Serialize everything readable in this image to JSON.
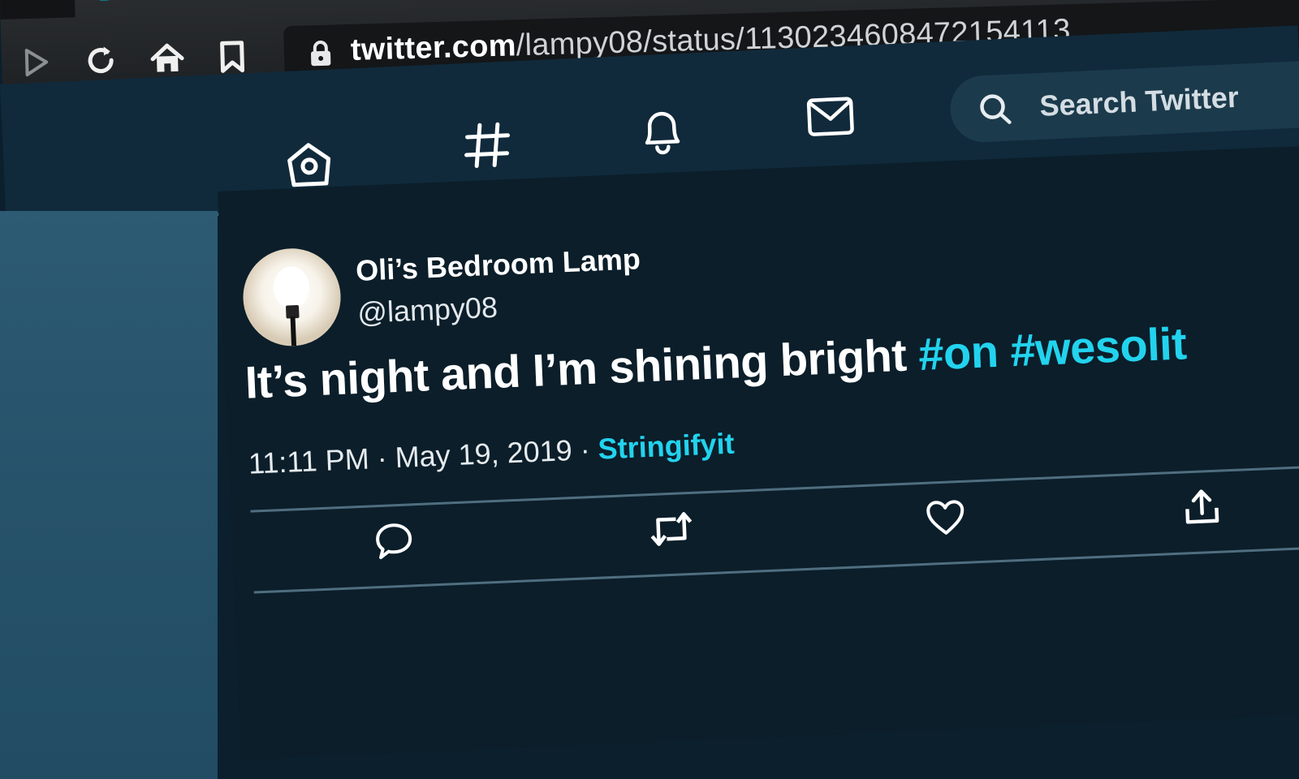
{
  "browser": {
    "url_domain": "twitter.com",
    "url_path": "/lampy08/status/1130234608472154113",
    "nav_icons": [
      "forward-icon",
      "reload-icon",
      "home-icon",
      "bookmark-icon"
    ],
    "lock_icon": "lock-icon"
  },
  "twitter_nav": {
    "icons": [
      "home-icon",
      "hashtag-explore-icon",
      "notifications-bell-icon",
      "messages-envelope-icon"
    ],
    "search_placeholder": "Search Twitter"
  },
  "tweet": {
    "display_name": "Oli’s Bedroom Lamp",
    "handle": "@lampy08",
    "text_plain": "It’s night and I’m shining bright",
    "hashtags": [
      "#on",
      "#wesolit"
    ],
    "time": "11:11 PM",
    "date": "May 19, 2019",
    "separator": "·",
    "source": "Stringifyit",
    "actions": [
      "reply-icon",
      "retweet-icon",
      "like-heart-icon",
      "share-icon"
    ]
  },
  "colors": {
    "page_bg": "#0b1f2c",
    "accent": "#22d3ee",
    "nav_bg": "#102a3b",
    "side_panel": "#2d5b73"
  }
}
